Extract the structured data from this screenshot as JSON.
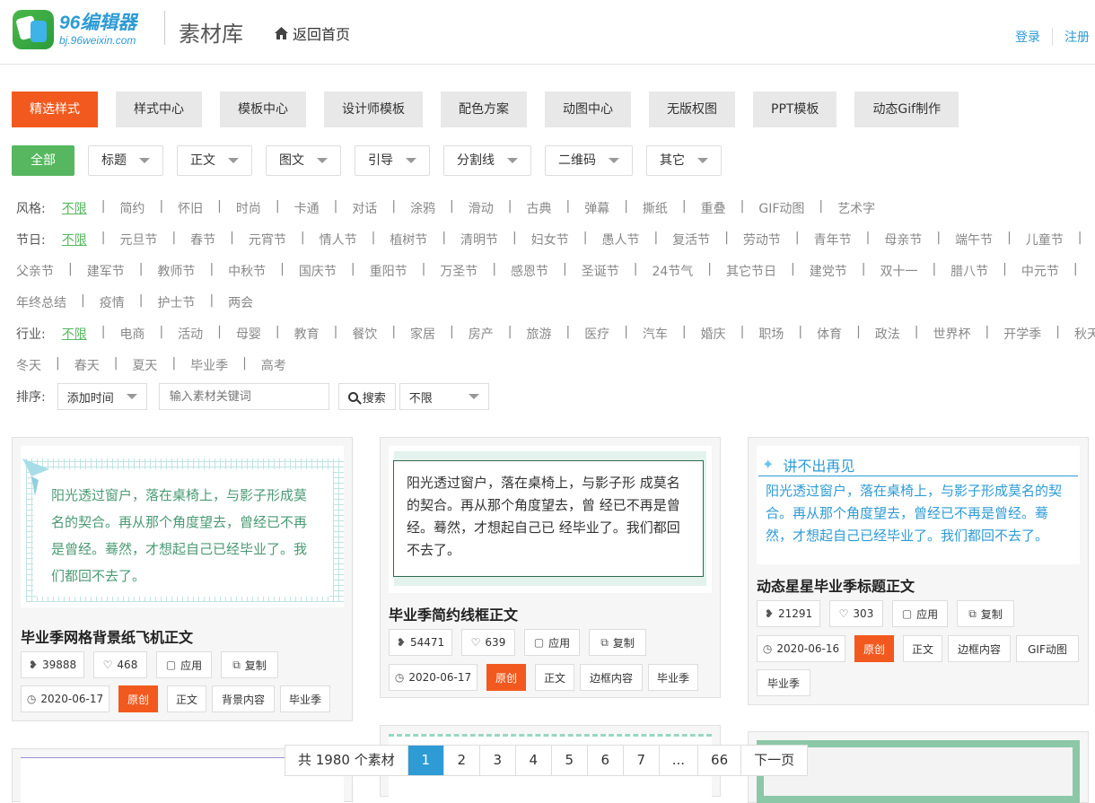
{
  "header": {
    "logo_main": "96编辑器",
    "logo_sub": "bj.96weixin.com",
    "site_title": "素材库",
    "home": "返回首页",
    "login": "登录",
    "register": "注册"
  },
  "tabs": [
    "精选样式",
    "样式中心",
    "模板中心",
    "设计师模板",
    "配色方案",
    "动图中心",
    "无版权图",
    "PPT模板",
    "动态Gif制作"
  ],
  "filters": {
    "all": "全部",
    "drops": [
      "标题",
      "正文",
      "图文",
      "引导",
      "分割线",
      "二维码",
      "其它"
    ]
  },
  "style_row": {
    "label": "风格:",
    "items": [
      "不限",
      "简约",
      "怀旧",
      "时尚",
      "卡通",
      "对话",
      "涂鸦",
      "滑动",
      "古典",
      "弹幕",
      "撕纸",
      "重叠",
      "GIF动图",
      "艺术字"
    ]
  },
  "holiday_row": {
    "label": "节日:",
    "line1": [
      "不限",
      "元旦节",
      "春节",
      "元宵节",
      "情人节",
      "植树节",
      "清明节",
      "妇女节",
      "愚人节",
      "复活节",
      "劳动节",
      "青年节",
      "母亲节",
      "端午节",
      "儿童节"
    ],
    "line2": [
      "父亲节",
      "建军节",
      "教师节",
      "中秋节",
      "国庆节",
      "重阳节",
      "万圣节",
      "感恩节",
      "圣诞节",
      "24节气",
      "其它节日",
      "建党节",
      "双十一",
      "腊八节",
      "中元节"
    ],
    "line3": [
      "年终总结",
      "疫情",
      "护士节",
      "两会"
    ]
  },
  "industry_row": {
    "label": "行业:",
    "line1": [
      "不限",
      "电商",
      "活动",
      "母婴",
      "教育",
      "餐饮",
      "家居",
      "房产",
      "旅游",
      "医疗",
      "汽车",
      "婚庆",
      "职场",
      "体育",
      "政法",
      "世界杯",
      "开学季",
      "秋天"
    ],
    "line2": [
      "冬天",
      "春天",
      "夏天",
      "毕业季",
      "高考"
    ]
  },
  "sort": {
    "label": "排序:",
    "order": "添加时间",
    "search_placeholder": "输入素材关键词",
    "search_btn": "搜索",
    "range": "不限"
  },
  "cards": [
    {
      "preview_text": "阳光透过窗户，落在桌椅上，与影子形成莫名的契合。再从那个角度望去，曾经已不再是曾经。蓦然，才想起自己已经毕业了。我们都回不去了。",
      "title": "毕业季网格背景纸飞机正文",
      "views": "39888",
      "likes": "468",
      "apply": "应用",
      "copy": "复制",
      "date": "2020-06-17",
      "original": "原创",
      "tags": [
        "正文",
        "背景内容",
        "毕业季"
      ]
    },
    {
      "preview_text": "阳光透过窗户，落在桌椅上，与影子形 成莫名的契合。再从那个角度望去，曾 经已不再是曾经。蓦然，才想起自己已 经毕业了。我们都回不去了。",
      "title": "毕业季简约线框正文",
      "views": "54471",
      "likes": "639",
      "apply": "应用",
      "copy": "复制",
      "date": "2020-06-17",
      "original": "原创",
      "tags": [
        "正文",
        "边框内容",
        "毕业季"
      ]
    },
    {
      "preview_heading": "讲不出再见",
      "preview_text": "阳光透过窗户，落在桌椅上，与影子形成莫名的契合。再从那个角度望去，曾经已不再是曾经。蓦然，才想起自己已经毕业了。我们都回不去了。",
      "title": "动态星星毕业季标题正文",
      "views": "21291",
      "likes": "303",
      "apply": "应用",
      "copy": "复制",
      "date": "2020-06-16",
      "original": "原创",
      "tags": [
        "正文",
        "边框内容",
        "GIF动图",
        "毕业季"
      ]
    }
  ],
  "pager": {
    "total": "共 1980 个素材",
    "pages": [
      "1",
      "2",
      "3",
      "4",
      "5",
      "6",
      "7",
      "...",
      "66"
    ],
    "next": "下一页"
  }
}
